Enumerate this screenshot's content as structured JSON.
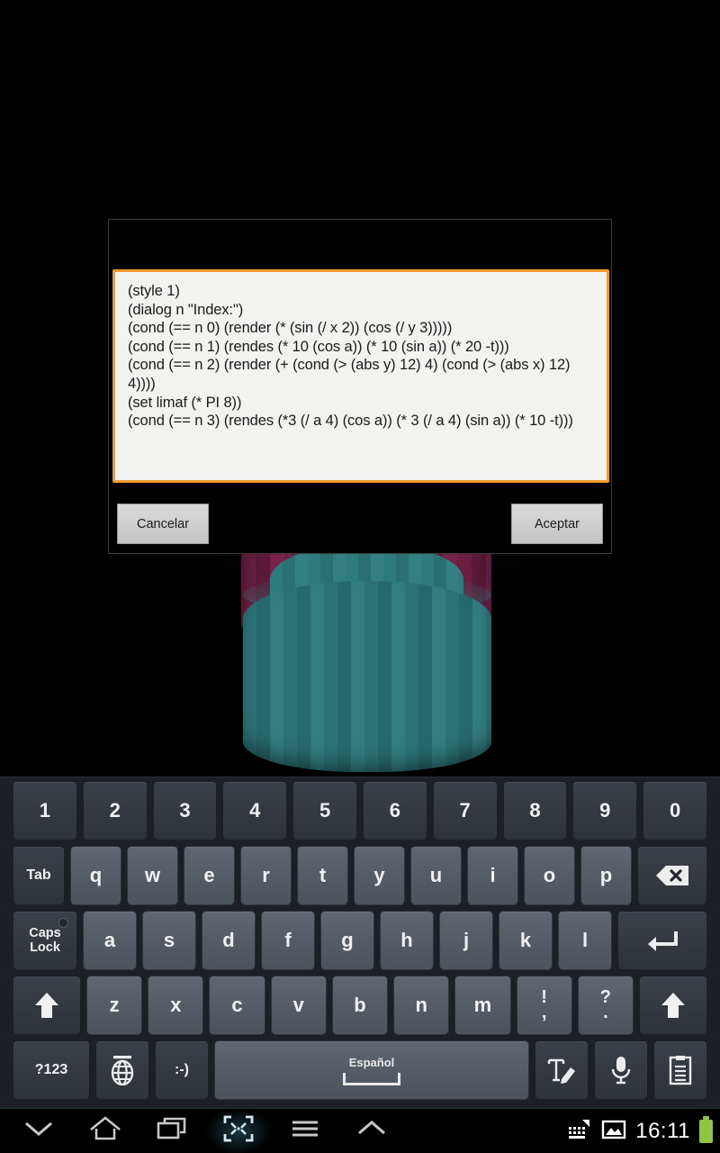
{
  "dialog": {
    "title": "",
    "code_text": "(style 1)\n(dialog n \"Index:\")\n(cond (== n 0) (render (* (sin (/ x 2)) (cos (/ y 3)))))\n(cond (== n 1) (rendes (* 10 (cos a)) (* 10 (sin a)) (* 20 -t)))\n(cond (== n 2) (render (+ (cond (> (abs y) 12) 4) (cond (> (abs x) 12) 4))))\n(set limaf (* PI 8))\n(cond (== n 3) (rendes (*3 (/ a 4) (cos a)) (* 3 (/ a 4) (sin a)) (* 10 -t)))",
    "cancel_label": "Cancelar",
    "accept_label": "Aceptar",
    "field_border_color": "#f29a2e",
    "field_background": "#f2f2f0"
  },
  "keyboard": {
    "language": "Español",
    "row_numbers": [
      "1",
      "2",
      "3",
      "4",
      "5",
      "6",
      "7",
      "8",
      "9",
      "0"
    ],
    "row_q": {
      "tab": "Tab",
      "letters": [
        "q",
        "w",
        "e",
        "r",
        "t",
        "y",
        "u",
        "i",
        "o",
        "p"
      ],
      "backspace_icon": "backspace-icon"
    },
    "row_a": {
      "caps_line1": "Caps",
      "caps_line2": "Lock",
      "letters": [
        "a",
        "s",
        "d",
        "f",
        "g",
        "h",
        "j",
        "k",
        "l"
      ],
      "enter_icon": "enter-icon"
    },
    "row_z": {
      "shift_left_icon": "shift-up-arrow-icon",
      "letters": [
        "z",
        "x",
        "c",
        "v",
        "b",
        "n",
        "m"
      ],
      "punct1_top": "!",
      "punct1_bottom": ",",
      "punct2_top": "?",
      "punct2_bottom": ".",
      "shift_right_icon": "shift-up-arrow-icon"
    },
    "row_bottom": {
      "symbols_label": "?123",
      "globe_icon": "globe-language-icon",
      "emoji_label": ":-)",
      "handwriting_icon": "handwriting-pen-icon",
      "mic_icon": "microphone-icon",
      "clipboard_icon": "clipboard-icon"
    }
  },
  "navbar": {
    "items": [
      {
        "name": "hide-keyboard-icon"
      },
      {
        "name": "home-icon"
      },
      {
        "name": "recent-apps-icon"
      },
      {
        "name": "screenshot-icon"
      },
      {
        "name": "menu-icon"
      },
      {
        "name": "expand-up-icon"
      }
    ],
    "status": {
      "keyboard_icon": "keyboard-status-icon",
      "screenshot_icon": "image-status-icon",
      "time": "16:11",
      "battery_icon": "battery-full-icon",
      "battery_color": "#8ec63f"
    }
  },
  "canvas": {
    "description": "3d-cylinder-render",
    "outer_color": "#2c7376",
    "inner_color": "#6d1f42"
  }
}
